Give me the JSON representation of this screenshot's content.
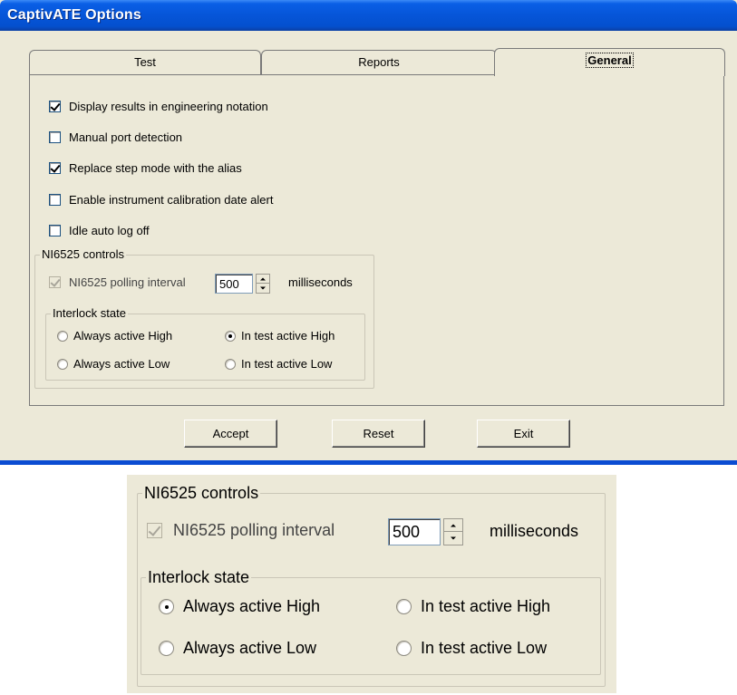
{
  "window": {
    "title": "CaptivATE Options"
  },
  "tabs": [
    {
      "label": "Test",
      "active": false
    },
    {
      "label": "Reports",
      "active": false
    },
    {
      "label": "General",
      "active": true
    }
  ],
  "general": {
    "options": [
      {
        "label": "Display results in engineering notation",
        "checked": true
      },
      {
        "label": "Manual port detection",
        "checked": false
      },
      {
        "label": "Replace step mode with the alias",
        "checked": true
      },
      {
        "label": "Enable instrument calibration date alert",
        "checked": false
      },
      {
        "label": "Idle auto log off",
        "checked": false
      }
    ],
    "ni6525": {
      "group_label": "NI6525 controls",
      "polling": {
        "label": "NI6525 polling interval",
        "checked": true,
        "enabled": false,
        "value": "500",
        "unit": "milliseconds"
      },
      "interlock": {
        "group_label": "Interlock state",
        "options": [
          {
            "label": "Always active High",
            "selected": false
          },
          {
            "label": "In test active High",
            "selected": true
          },
          {
            "label": "Always active Low",
            "selected": false
          },
          {
            "label": "In test active Low",
            "selected": false
          }
        ]
      }
    }
  },
  "buttons": {
    "accept": "Accept",
    "reset": "Reset",
    "exit": "Exit"
  },
  "zoom_inset": {
    "group_label": "NI6525 controls",
    "polling": {
      "label": "NI6525 polling interval",
      "checked": true,
      "enabled": false,
      "value": "500",
      "unit": "milliseconds"
    },
    "interlock": {
      "group_label": "Interlock state",
      "options": [
        {
          "label": "Always active High",
          "selected": true
        },
        {
          "label": "In test active High",
          "selected": false
        },
        {
          "label": "Always active Low",
          "selected": false
        },
        {
          "label": "In test active Low",
          "selected": false
        }
      ]
    }
  },
  "colors": {
    "titlebar": "#0655d8",
    "dialog_bg": "#ece9d8",
    "group_border": "#cac6b7"
  },
  "icons": [
    "checkbox",
    "radio-button",
    "spin-up-arrow-icon",
    "spin-down-arrow-icon"
  ]
}
